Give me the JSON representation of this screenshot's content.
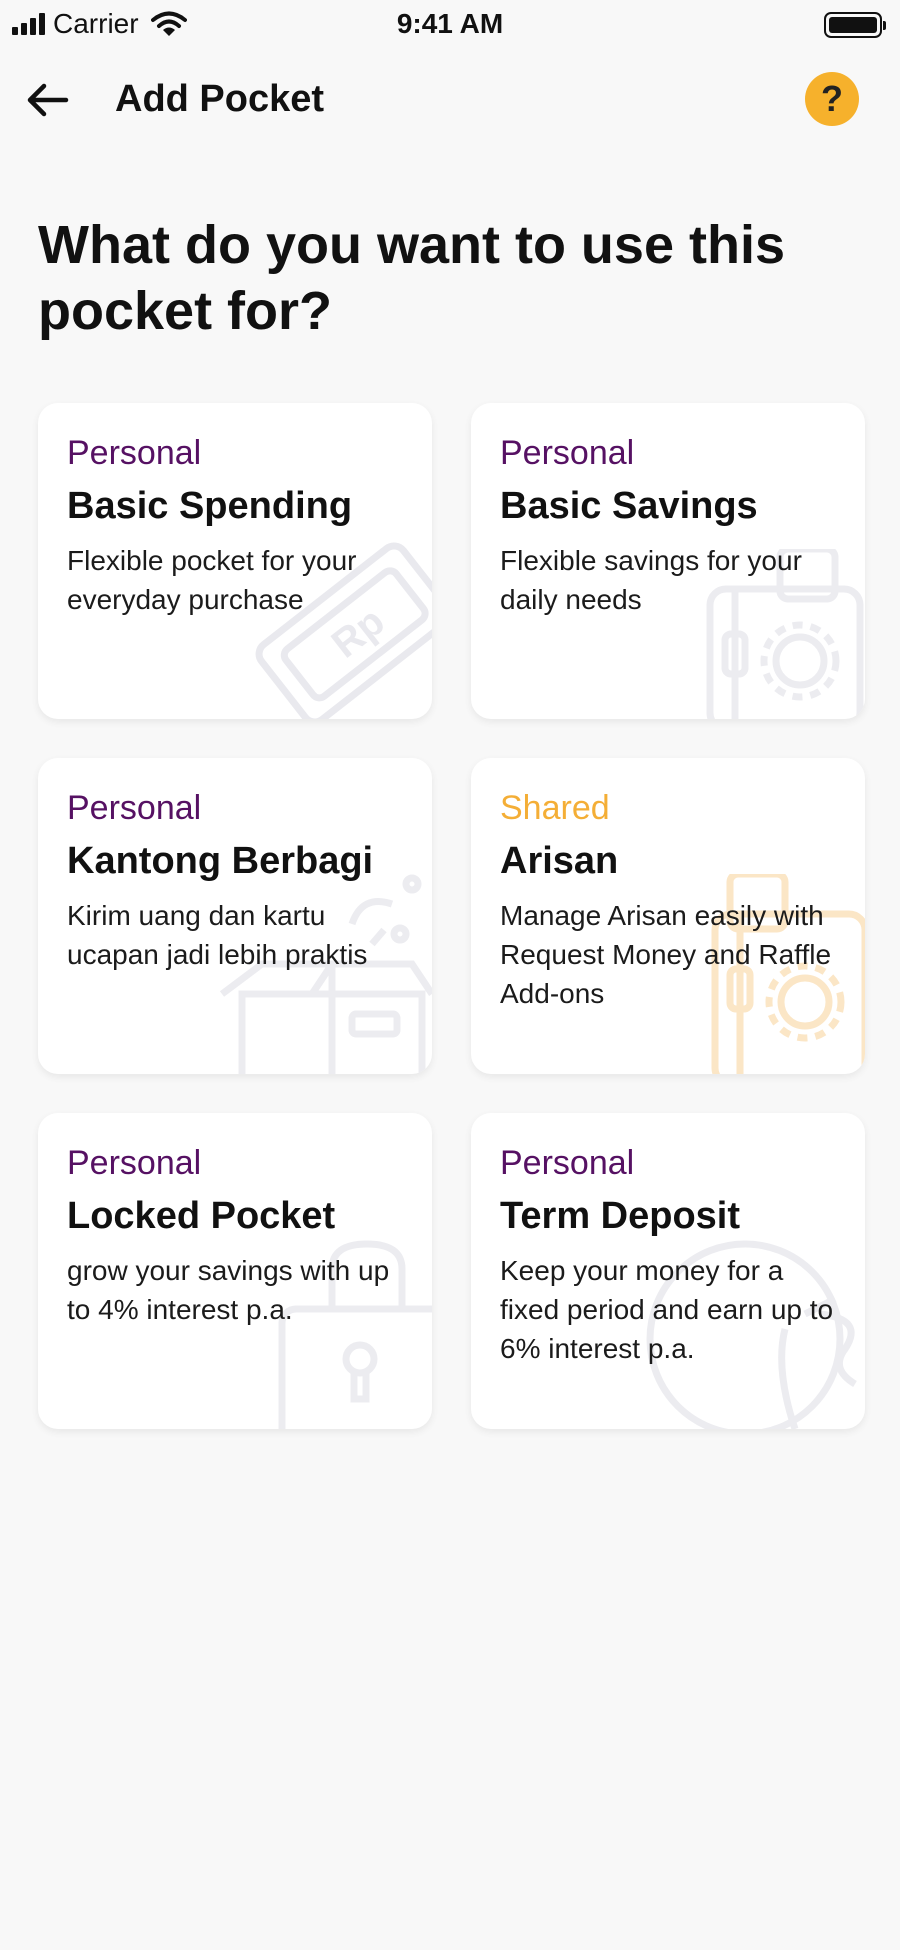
{
  "status_bar": {
    "carrier": "Carrier",
    "time": "9:41 AM"
  },
  "nav": {
    "title": "Add Pocket",
    "help_label": "?"
  },
  "headline": "What do you want to use this pocket for?",
  "cards": [
    {
      "tag": "Personal",
      "title": "Basic Spending",
      "description": "Flexible pocket for your everyday purchase",
      "icon": "ticket-icon"
    },
    {
      "tag": "Personal",
      "title": "Basic Savings",
      "description": "Flexible savings for your daily needs",
      "icon": "luggage-icon"
    },
    {
      "tag": "Personal",
      "title": "Kantong Berbagi",
      "description": "Kirim uang dan kartu ucapan jadi lebih praktis",
      "icon": "gift-box-icon"
    },
    {
      "tag": "Shared",
      "title": "Arisan",
      "description": "Manage Arisan easily with Request Money and Raffle Add-ons",
      "icon": "luggage-icon"
    },
    {
      "tag": "Personal",
      "title": "Locked Pocket",
      "description": "grow your savings with up to 4% interest p.a.",
      "icon": "lock-icon"
    },
    {
      "tag": "Personal",
      "title": "Term Deposit",
      "description": "Keep your money for a fixed period and earn up to 6% interest p.a.",
      "icon": "money-bag-icon"
    }
  ],
  "colors": {
    "personal_tag": "#561163",
    "shared_tag": "#f4ae36",
    "help_button": "#f6b12c",
    "background": "#f8f8f8"
  }
}
